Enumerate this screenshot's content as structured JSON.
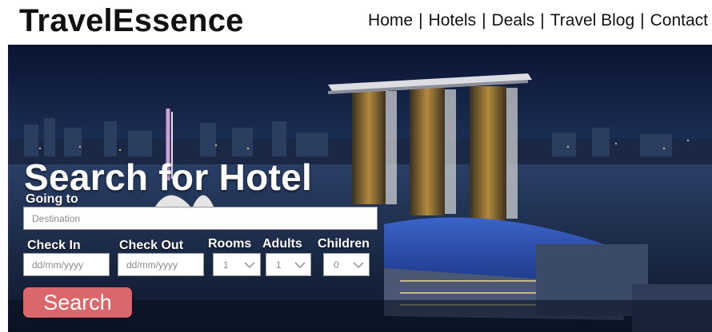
{
  "header": {
    "logo": "TravelEssence",
    "nav": [
      "Home",
      "Hotels",
      "Deals",
      "Travel Blog",
      "Contact"
    ],
    "separator": "|"
  },
  "search": {
    "title": "Search for Hotel",
    "going_to_label": "Going to",
    "destination_placeholder": "Destination",
    "check_in_label": "Check In",
    "check_out_label": "Check Out",
    "date_placeholder": "dd/mm/yyyy",
    "rooms_label": "Rooms",
    "adults_label": "Adults",
    "children_label": "Children",
    "rooms_value": "1",
    "adults_value": "1",
    "children_value": "0",
    "button_label": "Search"
  },
  "colors": {
    "button": "#d9676b",
    "hero_sky": "#1d2f5c"
  }
}
